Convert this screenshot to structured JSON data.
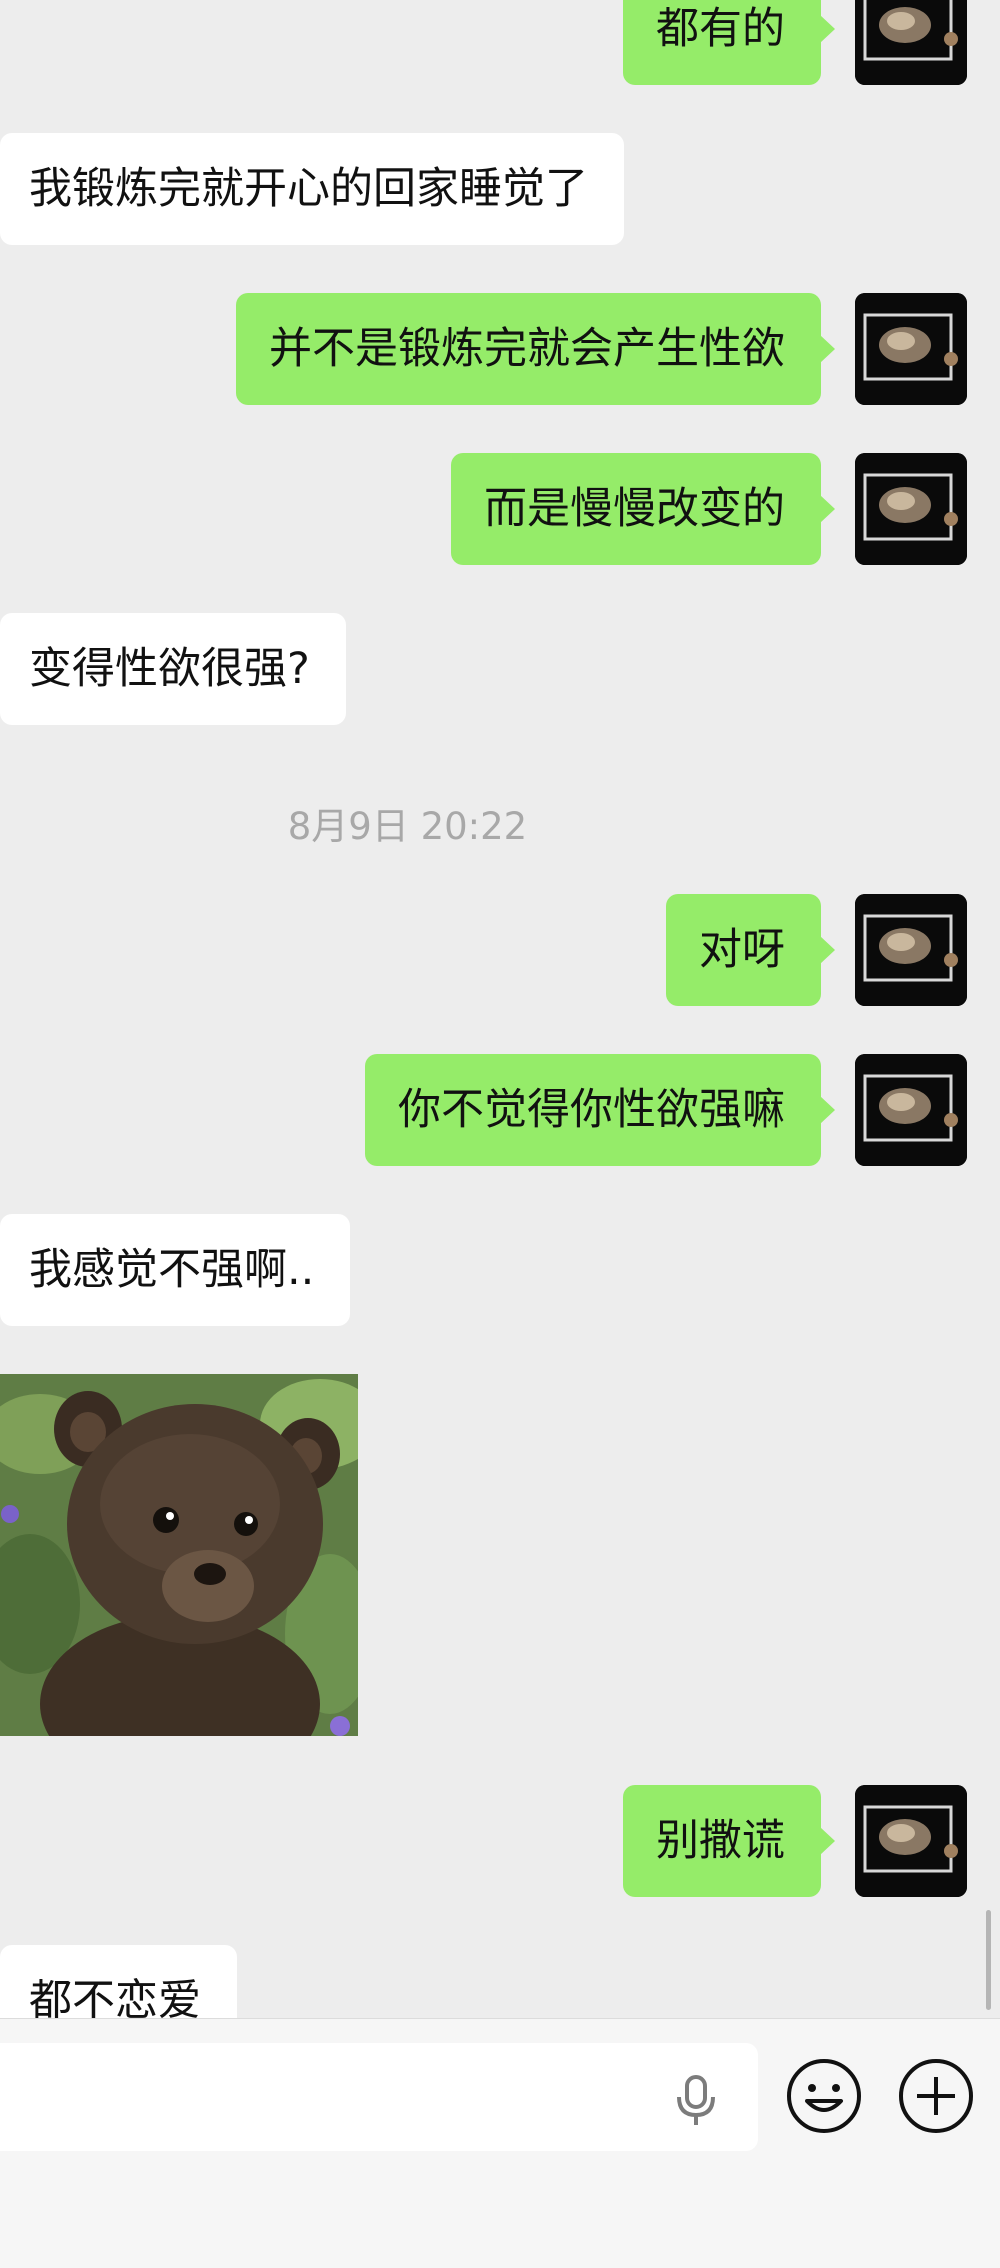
{
  "messages": [
    {
      "direction": "out",
      "text": "都有的"
    },
    {
      "direction": "in",
      "text": "我锻炼完就开心的回家睡觉了"
    },
    {
      "direction": "out",
      "text": "并不是锻炼完就会产生性欲"
    },
    {
      "direction": "out",
      "text": "而是慢慢改变的"
    },
    {
      "direction": "in",
      "text": "变得性欲很强?"
    },
    {
      "timestamp": "8月9日 20:22"
    },
    {
      "direction": "out",
      "text": "对呀"
    },
    {
      "direction": "out",
      "text": "你不觉得你性欲强嘛"
    },
    {
      "direction": "in",
      "text": "我感觉不强啊.."
    },
    {
      "direction": "in",
      "sticker": "bear-cub-sticker"
    },
    {
      "direction": "out",
      "text": "别撒谎"
    },
    {
      "direction": "in",
      "text": "都不恋爱"
    }
  ],
  "input_bar": {
    "text_value": "",
    "icons": [
      "microphone-icon",
      "emoji-icon",
      "plus-icon"
    ]
  },
  "colors": {
    "background": "#ededed",
    "outgoing_bubble": "#95ec69",
    "incoming_bubble": "#ffffff",
    "timestamp": "#a8a8a8"
  }
}
